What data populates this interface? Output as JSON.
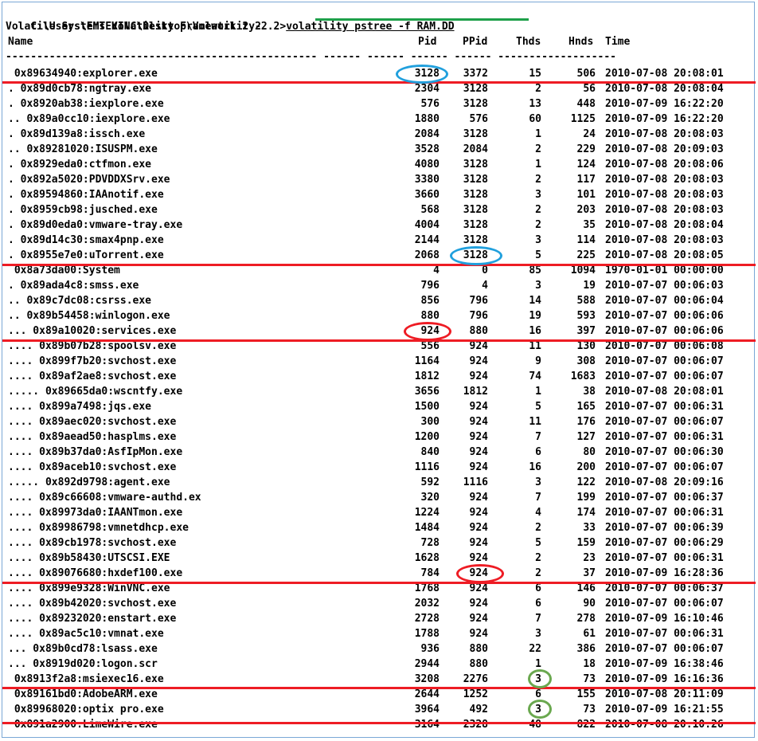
{
  "command": {
    "prompt": "C:\\Users\\EMTEKINC\\Desktop\\Volatility-2.2>",
    "text": "volatility pstree -f RAM.DD"
  },
  "banner": "Volatile Systems Volatility Framework 2.2",
  "columns": {
    "name": "Name",
    "pid": "Pid",
    "ppid": "PPid",
    "thds": "Thds",
    "hnds": "Hnds",
    "time": "Time"
  },
  "separator": "-------------------------------------------------- ------ ------ ------ ------ -------------------",
  "rows": [
    {
      "name": " 0x89634940:explorer.exe",
      "pid": "3128",
      "ppid": "3372",
      "thds": "15",
      "hnds": "506",
      "time": "2010-07-08 20:08:01"
    },
    {
      "name": ". 0x89d0cb78:ngtray.exe",
      "pid": "2304",
      "ppid": "3128",
      "thds": "2",
      "hnds": "56",
      "time": "2010-07-08 20:08:04"
    },
    {
      "name": ". 0x8920ab38:iexplore.exe",
      "pid": "576",
      "ppid": "3128",
      "thds": "13",
      "hnds": "448",
      "time": "2010-07-09 16:22:20"
    },
    {
      "name": ".. 0x89a0cc10:iexplore.exe",
      "pid": "1880",
      "ppid": "576",
      "thds": "60",
      "hnds": "1125",
      "time": "2010-07-09 16:22:20"
    },
    {
      "name": ". 0x89d139a8:issch.exe",
      "pid": "2084",
      "ppid": "3128",
      "thds": "1",
      "hnds": "24",
      "time": "2010-07-08 20:08:03"
    },
    {
      "name": ".. 0x89281020:ISUSPM.exe",
      "pid": "3528",
      "ppid": "2084",
      "thds": "2",
      "hnds": "229",
      "time": "2010-07-08 20:09:03"
    },
    {
      "name": ". 0x8929eda0:ctfmon.exe",
      "pid": "4080",
      "ppid": "3128",
      "thds": "1",
      "hnds": "124",
      "time": "2010-07-08 20:08:06"
    },
    {
      "name": ". 0x892a5020:PDVDDXSrv.exe",
      "pid": "3380",
      "ppid": "3128",
      "thds": "2",
      "hnds": "117",
      "time": "2010-07-08 20:08:03"
    },
    {
      "name": ". 0x89594860:IAAnotif.exe",
      "pid": "3660",
      "ppid": "3128",
      "thds": "3",
      "hnds": "101",
      "time": "2010-07-08 20:08:03"
    },
    {
      "name": ". 0x8959cb98:jusched.exe",
      "pid": "568",
      "ppid": "3128",
      "thds": "2",
      "hnds": "203",
      "time": "2010-07-08 20:08:03"
    },
    {
      "name": ". 0x89d0eda0:vmware-tray.exe",
      "pid": "4004",
      "ppid": "3128",
      "thds": "2",
      "hnds": "35",
      "time": "2010-07-08 20:08:04"
    },
    {
      "name": ". 0x89d14c30:smax4pnp.exe",
      "pid": "2144",
      "ppid": "3128",
      "thds": "3",
      "hnds": "114",
      "time": "2010-07-08 20:08:03"
    },
    {
      "name": ". 0x8955e7e0:uTorrent.exe",
      "pid": "2068",
      "ppid": "3128",
      "thds": "5",
      "hnds": "225",
      "time": "2010-07-08 20:08:05"
    },
    {
      "name": " 0x8a73da00:System",
      "pid": "4",
      "ppid": "0",
      "thds": "85",
      "hnds": "1094",
      "time": "1970-01-01 00:00:00"
    },
    {
      "name": ". 0x89ada4c8:smss.exe",
      "pid": "796",
      "ppid": "4",
      "thds": "3",
      "hnds": "19",
      "time": "2010-07-07 00:06:03"
    },
    {
      "name": ".. 0x89c7dc08:csrss.exe",
      "pid": "856",
      "ppid": "796",
      "thds": "14",
      "hnds": "588",
      "time": "2010-07-07 00:06:04"
    },
    {
      "name": ".. 0x89b54458:winlogon.exe",
      "pid": "880",
      "ppid": "796",
      "thds": "19",
      "hnds": "593",
      "time": "2010-07-07 00:06:06"
    },
    {
      "name": "... 0x89a10020:services.exe",
      "pid": "924",
      "ppid": "880",
      "thds": "16",
      "hnds": "397",
      "time": "2010-07-07 00:06:06"
    },
    {
      "name": ".... 0x89b07b28:spoolsv.exe",
      "pid": "556",
      "ppid": "924",
      "thds": "11",
      "hnds": "130",
      "time": "2010-07-07 00:06:08"
    },
    {
      "name": ".... 0x899f7b20:svchost.exe",
      "pid": "1164",
      "ppid": "924",
      "thds": "9",
      "hnds": "308",
      "time": "2010-07-07 00:06:07"
    },
    {
      "name": ".... 0x89af2ae8:svchost.exe",
      "pid": "1812",
      "ppid": "924",
      "thds": "74",
      "hnds": "1683",
      "time": "2010-07-07 00:06:07"
    },
    {
      "name": "..... 0x89665da0:wscntfy.exe",
      "pid": "3656",
      "ppid": "1812",
      "thds": "1",
      "hnds": "38",
      "time": "2010-07-08 20:08:01"
    },
    {
      "name": ".... 0x899a7498:jqs.exe",
      "pid": "1500",
      "ppid": "924",
      "thds": "5",
      "hnds": "165",
      "time": "2010-07-07 00:06:31"
    },
    {
      "name": ".... 0x89aec020:svchost.exe",
      "pid": "300",
      "ppid": "924",
      "thds": "11",
      "hnds": "176",
      "time": "2010-07-07 00:06:07"
    },
    {
      "name": ".... 0x89aead50:hasplms.exe",
      "pid": "1200",
      "ppid": "924",
      "thds": "7",
      "hnds": "127",
      "time": "2010-07-07 00:06:31"
    },
    {
      "name": ".... 0x89b37da0:AsfIpMon.exe",
      "pid": "840",
      "ppid": "924",
      "thds": "6",
      "hnds": "80",
      "time": "2010-07-07 00:06:30"
    },
    {
      "name": ".... 0x89aceb10:svchost.exe",
      "pid": "1116",
      "ppid": "924",
      "thds": "16",
      "hnds": "200",
      "time": "2010-07-07 00:06:07"
    },
    {
      "name": "..... 0x892d9798:agent.exe",
      "pid": "592",
      "ppid": "1116",
      "thds": "3",
      "hnds": "122",
      "time": "2010-07-08 20:09:16"
    },
    {
      "name": ".... 0x89c66608:vmware-authd.ex",
      "pid": "320",
      "ppid": "924",
      "thds": "7",
      "hnds": "199",
      "time": "2010-07-07 00:06:37"
    },
    {
      "name": ".... 0x89973da0:IAANTmon.exe",
      "pid": "1224",
      "ppid": "924",
      "thds": "4",
      "hnds": "174",
      "time": "2010-07-07 00:06:31"
    },
    {
      "name": ".... 0x89986798:vmnetdhcp.exe",
      "pid": "1484",
      "ppid": "924",
      "thds": "2",
      "hnds": "33",
      "time": "2010-07-07 00:06:39"
    },
    {
      "name": ".... 0x89cb1978:svchost.exe",
      "pid": "728",
      "ppid": "924",
      "thds": "5",
      "hnds": "159",
      "time": "2010-07-07 00:06:29"
    },
    {
      "name": ".... 0x89b58430:UTSCSI.EXE",
      "pid": "1628",
      "ppid": "924",
      "thds": "2",
      "hnds": "23",
      "time": "2010-07-07 00:06:31"
    },
    {
      "name": ".... 0x89076680:hxdef100.exe",
      "pid": "784",
      "ppid": "924",
      "thds": "2",
      "hnds": "37",
      "time": "2010-07-09 16:28:36"
    },
    {
      "name": ".... 0x899e9328:WinVNC.exe",
      "pid": "1768",
      "ppid": "924",
      "thds": "6",
      "hnds": "146",
      "time": "2010-07-07 00:06:37"
    },
    {
      "name": ".... 0x89b42020:svchost.exe",
      "pid": "2032",
      "ppid": "924",
      "thds": "6",
      "hnds": "90",
      "time": "2010-07-07 00:06:07"
    },
    {
      "name": ".... 0x89232020:enstart.exe",
      "pid": "2728",
      "ppid": "924",
      "thds": "7",
      "hnds": "278",
      "time": "2010-07-09 16:10:46"
    },
    {
      "name": ".... 0x89ac5c10:vmnat.exe",
      "pid": "1788",
      "ppid": "924",
      "thds": "3",
      "hnds": "61",
      "time": "2010-07-07 00:06:31"
    },
    {
      "name": "... 0x89b0cd78:lsass.exe",
      "pid": "936",
      "ppid": "880",
      "thds": "22",
      "hnds": "386",
      "time": "2010-07-07 00:06:07"
    },
    {
      "name": "... 0x8919d020:logon.scr",
      "pid": "2944",
      "ppid": "880",
      "thds": "1",
      "hnds": "18",
      "time": "2010-07-09 16:38:46"
    },
    {
      "name": " 0x8913f2a8:msiexec16.exe",
      "pid": "3208",
      "ppid": "2276",
      "thds": "3",
      "hnds": "73",
      "time": "2010-07-09 16:16:36"
    },
    {
      "name": " 0x89161bd0:AdobeARM.exe",
      "pid": "2644",
      "ppid": "1252",
      "thds": "6",
      "hnds": "155",
      "time": "2010-07-08 20:11:09"
    },
    {
      "name": " 0x89968020:optix pro.exe",
      "pid": "3964",
      "ppid": "492",
      "thds": "3",
      "hnds": "73",
      "time": "2010-07-09 16:21:55"
    },
    {
      "name": " 0x891a2900:LimeWire.exe",
      "pid": "3164",
      "ppid": "2328",
      "thds": "48",
      "hnds": "822",
      "time": "2010-07-08 20:10:26"
    }
  ]
}
